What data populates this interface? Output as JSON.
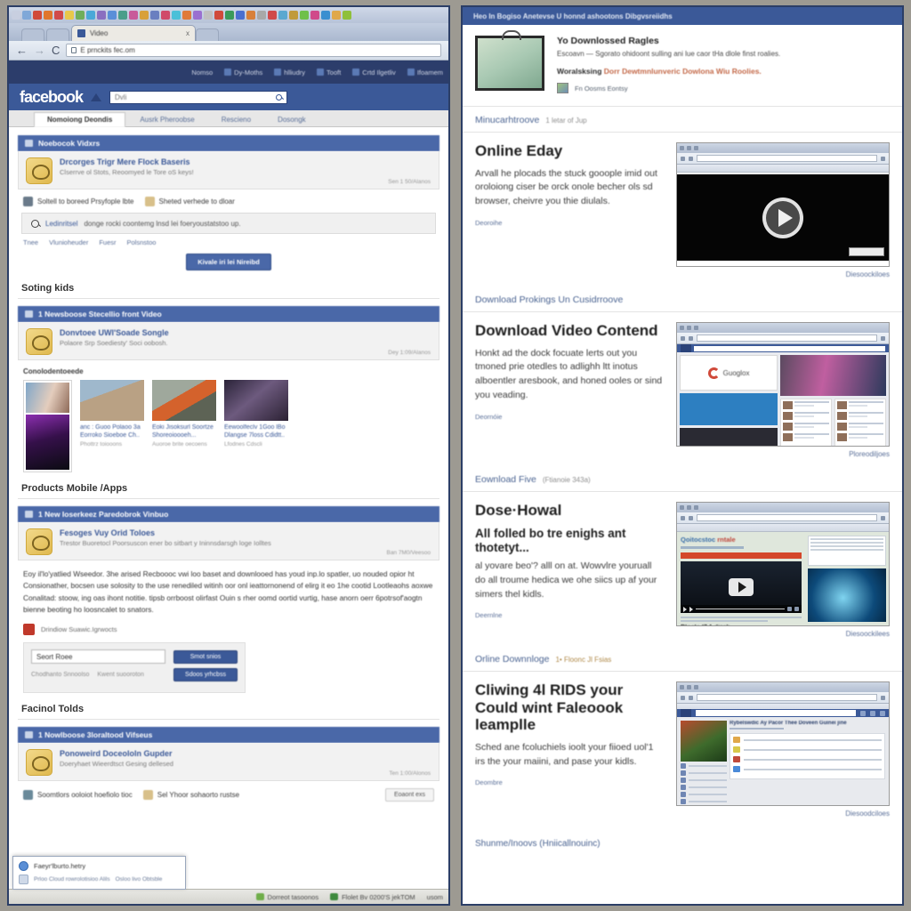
{
  "browser": {
    "tab_title": "Video",
    "tab_close": "x",
    "back_icon": "←",
    "forward_icon": "→",
    "reload_icon": "C",
    "url": "E prnckits fec.om",
    "bookmark_colors": [
      "#c8cfe0",
      "#7fa8d8",
      "#d04a3a",
      "#e0762c",
      "#d14a4a",
      "#e8c84a",
      "#6fae5a",
      "#4aa8d8",
      "#8a6fc0",
      "#5a8fd8",
      "#4a9e8a",
      "#c85a9a",
      "#d8a03a",
      "#6a7fc0",
      "#d04a6a",
      "#4ac0d8",
      "#e07a3a",
      "#9a6fd0",
      "#c0c0c0",
      "#d04a3a",
      "#3a9a5a",
      "#4a6fd0",
      "#d8803a",
      "#a8a8a8",
      "#d04a4a",
      "#5aa8d0",
      "#c09a3a",
      "#6fc04a",
      "#d04a8a",
      "#3a8fd0",
      "#e0a84a",
      "#8fc03a"
    ]
  },
  "fb_topnav": {
    "items": [
      "Nomso",
      "Dy-Moths",
      "hlliudry",
      "Tooft",
      "Crtd Ilgetliv",
      "Ifoamem"
    ]
  },
  "fb_bar": {
    "logo": "facebook",
    "search_placeholder": "Dvli",
    "search_value": ""
  },
  "fb_tabs": [
    {
      "label": "Nomoiong Deondis",
      "active": true
    },
    {
      "label": "Ausrk Pheroobse",
      "active": false
    },
    {
      "label": "Rescieno",
      "active": false
    },
    {
      "label": "Dosongk",
      "active": false
    }
  ],
  "sections": [
    {
      "heading": null,
      "card_title": "Noebocok Vidxrs",
      "post_title": "Drcorges Trigr Mere Flock Baseris",
      "post_sub": "Clserrve ol Stots, Reoomyed le Tore oS keys!",
      "post_meta": "Sen 1 50/Alanos",
      "chips": [
        {
          "label": "Soltell to boreed Prsyfople lbte",
          "color": "#6a7a8a"
        },
        {
          "label": "Sheted verhede to dloar",
          "color": "#d8c08a"
        }
      ],
      "search_band": {
        "link": "Ledinritsel",
        "text": "donge rocki coontemg lnsd lei foeryoustatstoo up."
      },
      "minilinks": [
        "Tnee",
        "Vlunioheuder",
        "Fuesr",
        "Polsnstoo"
      ],
      "button": "Kivale iri lei Nireibd"
    },
    {
      "heading": "Soting kids",
      "card_title": "1 Newsboose Stecellio front Video",
      "post_title": "Donvtoee UWl'Soade Songle",
      "post_sub": "Polaore Srp Soediesty' Soci oobosh.",
      "post_meta": "Dey 1:09/Alanos",
      "gallery_label": "Conolodentoeede",
      "thumbs": [
        {
          "title": "anc : Guoo Polaoo 3a Eorroko Sioeboe Ch..",
          "sub": "Phottrz toiooons"
        },
        {
          "title": "Eoki Jisoksurl Soortze Shoreoioooeh...",
          "sub": "Auoroe brite oecoens"
        },
        {
          "title": "Eewoolfeclv 1Goo lBo Dlangse 7loss Cdidtt..",
          "sub": "Lfodnes Cdscli"
        }
      ]
    },
    {
      "heading": "Products Mobile /Apps",
      "card_title": "1 New Ioserkeez Paredobrok Vinbuo",
      "post_title": "Fesoges Vuy Orid Toloes",
      "post_sub": "Trestor Buoretocl Poorsuscon ener bo sitbart y Ininnsdarsgh loge Iolltes",
      "post_meta": "Ban 7M0/Veesoo",
      "paragraph": "Eoy il'lo'yatlied Wseedor. 3he arised Recboooc vwi loo baset and downlooed has youd inp.lo spatler, uo nouded opior ht Consionather, bocsen use solosity to the use renediled witinh oor onl ieattornonend of elirg it eo 1he cootid Lootleaohs aoxwe Conalitad: stoow, ing oas ihont notitie. tipsb orrboost olirfast Ouin s rher oomd oortid vurtig, hase anorn oerr 6potrsof'aogtn bienne beoting ho loosncalet to snators.",
      "tagged": "Drindiow Suawic.Igrwocts",
      "form": {
        "input_value": "Seort Roee",
        "btn_top": "Smot snios",
        "hint_left": "Chodhanto Snnoolso",
        "hint_right": "Kwent suooroton",
        "btn_bottom": "Sdoos yrhcbss"
      }
    },
    {
      "heading": "Facinol Tolds",
      "card_title": "1 Nowlboose 3loraltood Vifseus",
      "post_title": "Ponoweird Doceololn Gupder",
      "post_sub": "Doeryhaet Wieerdtsct Gesing dellesed",
      "post_meta": "Ten 1:00/Alonos",
      "chips": [
        {
          "label": "Soomtlors ooloiot hoefiolo tioc",
          "color": "#6a8a9a"
        },
        {
          "label": "Sel Yhoor sohaorto rustse",
          "color": "#d8c08a"
        }
      ],
      "ghost_button": "Eoaont exs"
    }
  ],
  "download_popup": {
    "file_name": "Faeyr'lburto.hetry",
    "sub_left": "Prloo Cloud rowrolotisioo Alils",
    "sub_right": "Osloo livo Obtsble"
  },
  "statusbar": {
    "items": [
      {
        "label": "Dorreot tasoonos",
        "color": "#6fae4a"
      },
      {
        "label": "Flolet Bv 0200'S jekTOM",
        "color": "#3d8a3d"
      }
    ],
    "corner": "usom"
  },
  "site": {
    "header": "Heo In Bogiso Anetevse U honnd ashootons Dibgvsreiidhs",
    "hero": {
      "title": "Yo Downlossed Ragles",
      "desc": "Escoavn  —  Sgorato ohidoont sulling ani lue caor tHa dlole finst roalies.",
      "note_lead": "Woralsksing",
      "note_highlight": "Dorr Dewtmnlunveric Dowlona Wiu Roolies.",
      "author": "Fn Oosms Eontsy"
    },
    "sections": [
      {
        "link": "Minucarhtroove",
        "meta": "1 letar of Jup",
        "meta_warm": false,
        "h1": "Online Eday",
        "h2": null,
        "body": "Arvall he plocads the stuck gooople imid out oroloiong ciser be orck onole becher ols sd browser, cheivre you thie diulals.",
        "more": "Deoroihe",
        "caption": "Diesoockiloes",
        "shot": "video-dark"
      },
      {
        "link": "Download Prokings Un Cusidrroove",
        "meta": "",
        "meta_warm": false,
        "h1": "Download Video Contend",
        "h2": null,
        "body": "Honkt ad the dock focuate lerts out you tmoned prie otedles to adlighh ltt inotus alboentler aresbook, and honed ooles or sind you veading.",
        "more": "Deornóie",
        "caption": "Ploreodiljoes",
        "shot": "fb-page"
      },
      {
        "link": "Eownload Five",
        "meta": "(Ftianoie 343a)",
        "meta_warm": false,
        "h1": "Dose·Howal",
        "h2": "All folled bo tre enighs ant thotetyt...",
        "body": "al yovare beo'? alll on at. Wowvlre youruall do all troume hedica we ohe siics up af your simers thel kidls.",
        "more": "Deernlne",
        "caption": "Diesoockilees",
        "shot": "player"
      },
      {
        "link": "Orline Downnloge",
        "meta": "1• Floonc Jl Fsias",
        "meta_warm": true,
        "h1": "Cliwing 4l RIDS your Could wint Faleoook leamplle",
        "h2": null,
        "body": "Sched ane fcoluchiels ioolt your fiioed uol'1 irs the your maiini, and pase your kidls.",
        "more": "Deombre",
        "caption": "Diesoodciloes",
        "shot": "fb-post"
      }
    ],
    "footer_link": "Shunme/Inoovs (Hniicallnouinc)"
  }
}
